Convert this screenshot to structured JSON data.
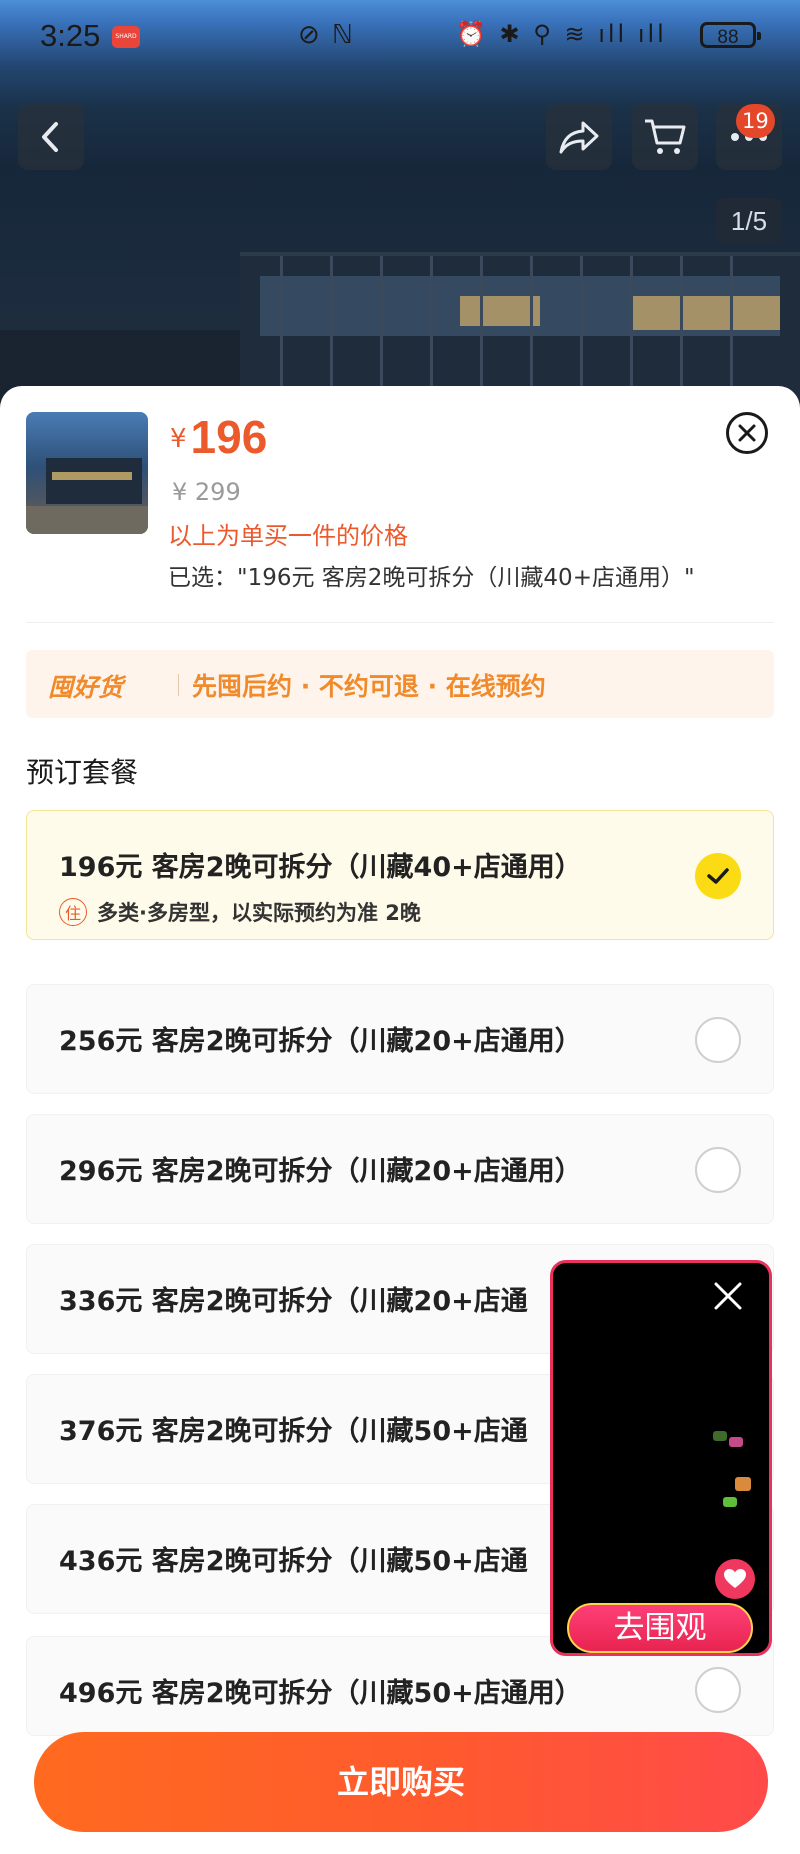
{
  "status_bar": {
    "time": "3:25",
    "app_badge": "SHARD",
    "middle_icons": "⊘ ℕ",
    "right_icons": "⏰ ✱ ⚲ ≋ ıll ıll",
    "battery": "88"
  },
  "gallery": {
    "cart_badge": "19",
    "pager": "1/5"
  },
  "product": {
    "currency": "¥",
    "price": "196",
    "original_price": "¥ 299",
    "price_note": "以上为单买一件的价格",
    "selected_text": "已选：\"196元 客房2晚可拆分（川藏40+店通用）\""
  },
  "promo": {
    "brand": "囤好货",
    "text": "先囤后约 · 不约可退 · 在线预约"
  },
  "section_title": "预订套餐",
  "packages": [
    {
      "label": "196元 客房2晚可拆分（川藏40+店通用）",
      "tag": "住",
      "sub": "多类·多房型，以实际预约为准 2晚",
      "selected": true
    },
    {
      "label": "256元 客房2晚可拆分（川藏20+店通用）",
      "selected": false
    },
    {
      "label": "296元 客房2晚可拆分（川藏20+店通用）",
      "selected": false
    },
    {
      "label": "336元 客房2晚可拆分（川藏20+店通",
      "selected": false
    },
    {
      "label": "376元 客房2晚可拆分（川藏50+店通",
      "selected": false
    },
    {
      "label": "436元 客房2晚可拆分（川藏50+店通",
      "selected": false
    },
    {
      "label": "496元 客房2晚可拆分（川藏50+店通用）",
      "selected": false
    }
  ],
  "buy_button": "立即购买",
  "floating_video": {
    "button": "去围观"
  },
  "colors": {
    "accent": "#ec5a2c",
    "selected_check": "#fadb14",
    "buy_gradient_start": "#ff6a1f",
    "buy_gradient_end": "#ff4a4a",
    "live_pink": "#e8315b"
  }
}
